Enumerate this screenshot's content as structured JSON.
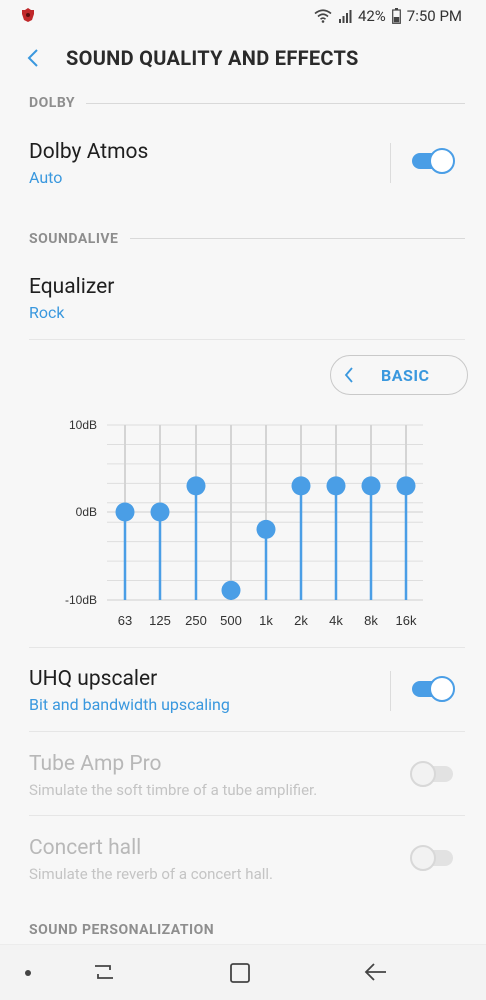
{
  "status_bar": {
    "battery": "42%",
    "time": "7:50 PM",
    "icons": [
      "app-icon",
      "wifi-icon",
      "signal-icon",
      "battery-icon"
    ]
  },
  "header": {
    "title": "SOUND QUALITY AND EFFECTS",
    "back_icon": "chevron-left-icon"
  },
  "sections": {
    "dolby": "DOLBY",
    "soundalive": "SOUNDALIVE",
    "personalization": "SOUND PERSONALIZATION"
  },
  "dolby_atmos": {
    "title": "Dolby Atmos",
    "subtitle": "Auto",
    "enabled": true
  },
  "equalizer": {
    "title": "Equalizer",
    "subtitle": "Rock",
    "basic_button": "BASIC",
    "y_labels": [
      "10dB",
      "0dB",
      "-10dB"
    ],
    "bands": [
      "63",
      "125",
      "250",
      "500",
      "1k",
      "2k",
      "4k",
      "8k",
      "16k"
    ],
    "levels_db": [
      0,
      0,
      3,
      -9,
      -2,
      3,
      3,
      3,
      3
    ],
    "accent": "#4a9ee6"
  },
  "uhq": {
    "title": "UHQ upscaler",
    "subtitle": "Bit and bandwidth upscaling",
    "enabled": true
  },
  "tube_amp": {
    "title": "Tube Amp Pro",
    "subtitle": "Simulate the soft timbre of a tube amplifier.",
    "enabled": false,
    "disabled": true
  },
  "concert_hall": {
    "title": "Concert hall",
    "subtitle": "Simulate the reverb of a concert hall.",
    "enabled": false,
    "disabled": true
  },
  "navbar": {
    "icons": [
      "dot-icon",
      "recent-apps-icon",
      "home-icon",
      "back-arrow-icon"
    ]
  }
}
